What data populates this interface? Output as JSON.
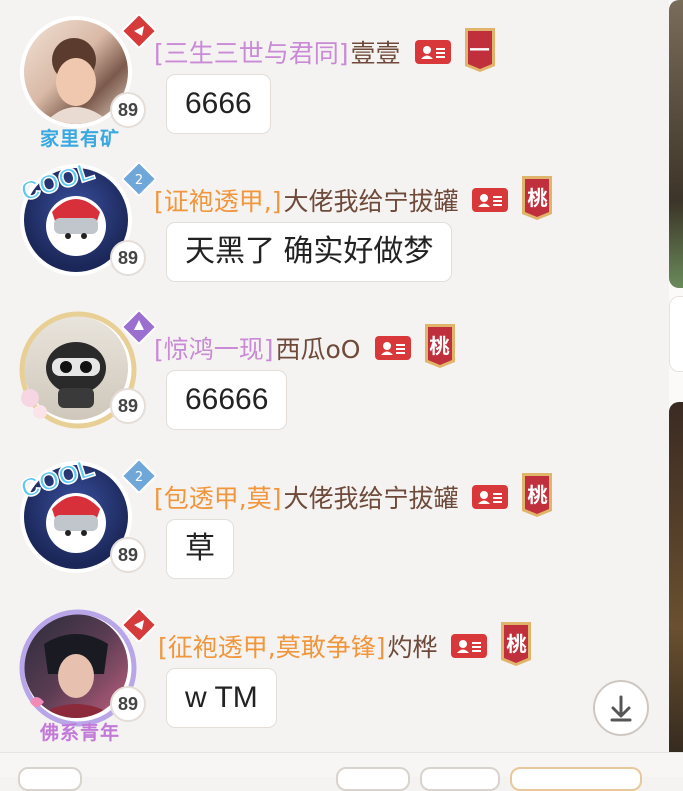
{
  "messages": [
    {
      "tag": "[三生三世与君同]",
      "tag_color": "#c98ad6",
      "nickname": "壹壹",
      "rank_label": "一",
      "level": "89",
      "frame_caption": "家里有矿",
      "frame_caption_color": "#3aa8e0",
      "text": "6666"
    },
    {
      "tag": "[证袍透甲,]",
      "tag_color": "#f0963c",
      "nickname": "大佬我给宁拔罐",
      "rank_label": "桃",
      "level": "89",
      "frame_caption": "",
      "frame_caption_color": "#3aa8e0",
      "text": "天黑了  确实好做梦"
    },
    {
      "tag": "[惊鸿一现]",
      "tag_color": "#c98ad6",
      "nickname": "西瓜oO",
      "rank_label": "桃",
      "level": "89",
      "frame_caption": "",
      "frame_caption_color": "#3aa8e0",
      "text": "66666"
    },
    {
      "tag": "[包透甲,莫]",
      "tag_color": "#f0963c",
      "nickname": "大佬我给宁拔罐",
      "rank_label": "桃",
      "level": "89",
      "frame_caption": "",
      "frame_caption_color": "#3aa8e0",
      "text": "草"
    },
    {
      "tag": "[征袍透甲,莫敢争锋]",
      "tag_color": "#f0963c",
      "nickname": "灼桦",
      "rank_label": "桃",
      "level": "89",
      "frame_caption": "佛系青年",
      "frame_caption_color": "#c27ad8",
      "text": "w TM"
    }
  ],
  "icons": {
    "card": "user-card-icon",
    "scroll": "arrow-down-icon"
  },
  "colors": {
    "card_red": "#d8383a",
    "rank_red": "#c0303c",
    "rank_gold": "#e0b46a"
  }
}
